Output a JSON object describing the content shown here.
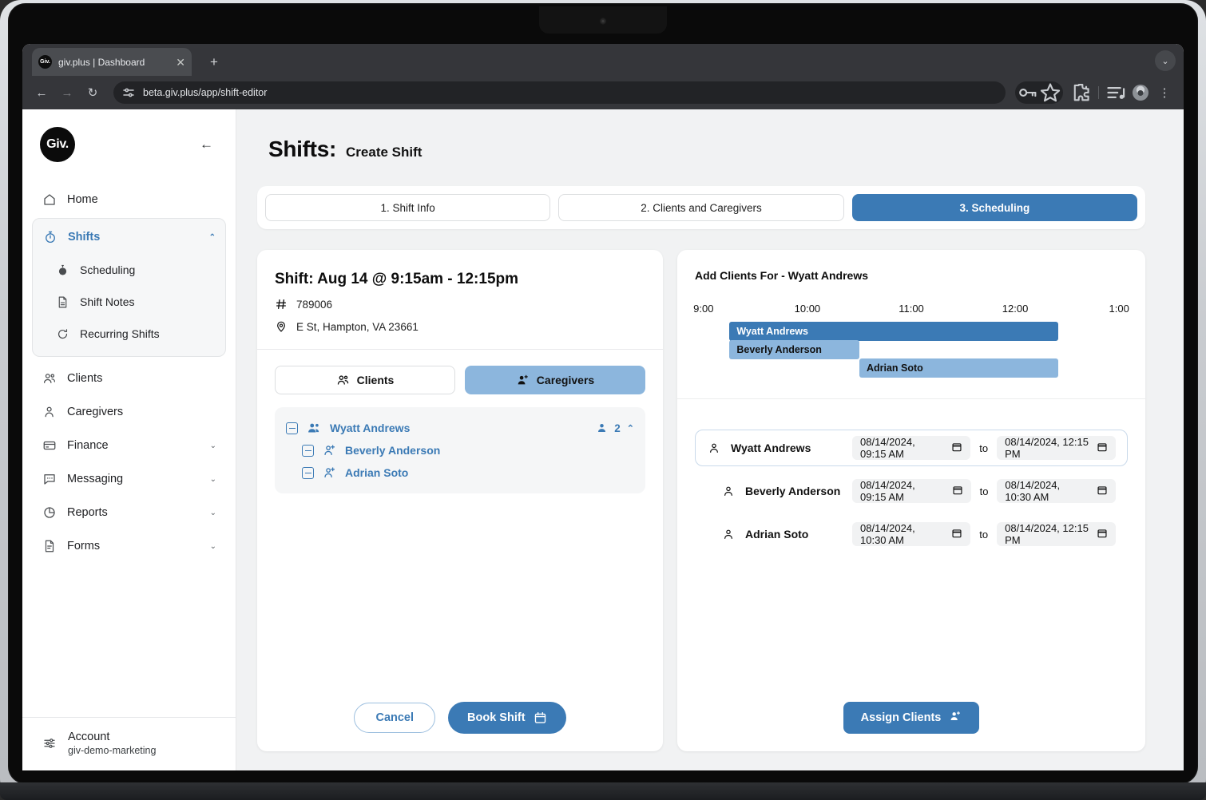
{
  "browser": {
    "tab": {
      "favicon_label": "Giv.",
      "title": "giv.plus | Dashboard",
      "close_icon": "close-icon"
    },
    "new_tab_label": "+",
    "tab_list_chevron": "⌄",
    "back_icon": "←",
    "forward_icon": "→",
    "reload_icon": "↻",
    "url": "beta.giv.plus/app/shift-editor",
    "site_settings_icon": "tune-icon",
    "password_icon": "key-icon",
    "bookmark_icon": "star-icon",
    "extensions_icon": "puzzle-icon",
    "media_icon": "playlist-icon",
    "profile_icon": "avatar",
    "menu_icon": "⋮"
  },
  "sidebar": {
    "logo_text": "Giv.",
    "collapse_icon": "←",
    "items": [
      {
        "label": "Home",
        "icon": "home-icon",
        "chevron": ""
      },
      {
        "label": "Shifts",
        "icon": "stopwatch-icon",
        "chevron": "⌃",
        "active": true,
        "children": [
          {
            "label": "Scheduling",
            "icon": "stopwatch-filled-icon"
          },
          {
            "label": "Shift Notes",
            "icon": "document-icon"
          },
          {
            "label": "Recurring Shifts",
            "icon": "refresh-icon"
          }
        ]
      },
      {
        "label": "Clients",
        "icon": "clients-icon",
        "chevron": ""
      },
      {
        "label": "Caregivers",
        "icon": "caregiver-icon",
        "chevron": ""
      },
      {
        "label": "Finance",
        "icon": "card-icon",
        "chevron": "⌄"
      },
      {
        "label": "Messaging",
        "icon": "chat-icon",
        "chevron": "⌄"
      },
      {
        "label": "Reports",
        "icon": "pie-chart-icon",
        "chevron": "⌄"
      },
      {
        "label": "Forms",
        "icon": "form-icon",
        "chevron": "⌄"
      }
    ],
    "account": {
      "icon": "sliders-icon",
      "name": "Account",
      "org": "giv-demo-marketing"
    }
  },
  "header": {
    "title": "Shifts:",
    "subtitle": "Create Shift"
  },
  "steps": [
    {
      "label": "1. Shift Info",
      "active": false
    },
    {
      "label": "2. Clients and Caregivers",
      "active": false
    },
    {
      "label": "3. Scheduling",
      "active": true
    }
  ],
  "shift": {
    "title": "Shift: Aug 14 @ 9:15am - 12:15pm",
    "id_icon": "hash-icon",
    "id": "789006",
    "location_icon": "pin-icon",
    "location": "E St, Hampton, VA 23661",
    "toggles": [
      {
        "label": "Clients",
        "icon": "clients-icon",
        "active": false
      },
      {
        "label": "Caregivers",
        "icon": "caregiver-add-icon",
        "active": true
      }
    ],
    "tree": {
      "parent": {
        "name": "Wyatt Andrews",
        "icon": "clients-icon",
        "count": "2",
        "count_icon": "person-icon",
        "chevron": "⌃"
      },
      "children": [
        {
          "name": "Beverly Anderson",
          "icon": "person-add-icon"
        },
        {
          "name": "Adrian Soto",
          "icon": "person-add-icon"
        }
      ]
    },
    "cancel_label": "Cancel",
    "book_label": "Book Shift",
    "book_icon": "calendar-icon"
  },
  "assign": {
    "title": "Add Clients For - Wyatt Andrews",
    "assign_label": "Assign Clients",
    "assign_icon": "person-add-icon",
    "to_label": "to",
    "calendar_icon": "calendar-icon",
    "person_icon": "person-icon",
    "rows": [
      {
        "name": "Wyatt Andrews",
        "start": "08/14/2024, 09:15 AM",
        "end": "08/14/2024, 12:15 PM",
        "selected": true,
        "indent": false
      },
      {
        "name": "Beverly Anderson",
        "start": "08/14/2024, 09:15 AM",
        "end": "08/14/2024, 10:30 AM",
        "selected": false,
        "indent": true
      },
      {
        "name": "Adrian Soto",
        "start": "08/14/2024, 10:30 AM",
        "end": "08/14/2024, 12:15 PM",
        "selected": false,
        "indent": true
      }
    ]
  },
  "chart_data": {
    "type": "bar",
    "title": "Add Clients For - Wyatt Andrews",
    "orientation": "horizontal-gantt",
    "xlabel": "",
    "ylabel": "",
    "axis_ticks": [
      "9:00",
      "10:00",
      "11:00",
      "12:00",
      "1:00"
    ],
    "axis_tick_positions_pct": [
      2,
      26,
      50,
      74,
      98
    ],
    "xlim": [
      "9:00",
      "1:00"
    ],
    "grid": false,
    "legend": "none",
    "colors": {
      "primary": "#3b7ab5",
      "secondary": "#8cb6dd"
    },
    "series": [
      {
        "name": "Wyatt Andrews",
        "start": "9:15",
        "end": "12:15",
        "start_pct": 8,
        "width_pct": 76,
        "color": "#3b7ab5",
        "text_color": "#ffffff"
      },
      {
        "name": "Beverly Anderson",
        "start": "9:15",
        "end": "10:30",
        "start_pct": 8,
        "width_pct": 30,
        "color": "#8cb6dd",
        "text_color": "#111111"
      },
      {
        "name": "Adrian Soto",
        "start": "10:30",
        "end": "12:15",
        "start_pct": 38,
        "width_pct": 46,
        "color": "#8cb6dd",
        "text_color": "#111111"
      }
    ]
  }
}
